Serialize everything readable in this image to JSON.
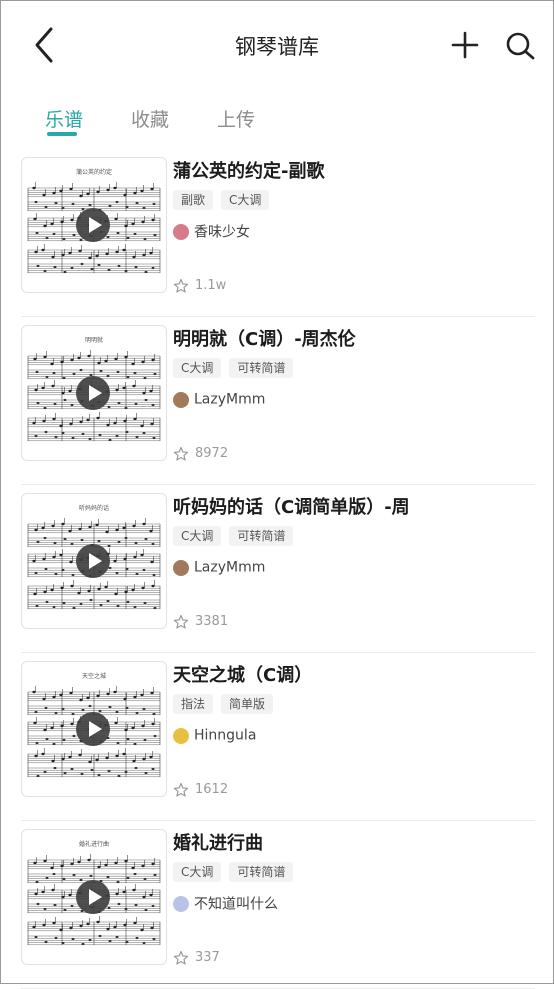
{
  "header": {
    "title": "钢琴谱库"
  },
  "tabs": [
    {
      "label": "乐谱",
      "active": true
    },
    {
      "label": "收藏",
      "active": false
    },
    {
      "label": "上传",
      "active": false
    }
  ],
  "colors": {
    "accent": "#2aa7a7"
  },
  "items": [
    {
      "title": "蒲公英的约定-副歌",
      "thumb_caption": "蒲公英的约定",
      "tags": [
        "副歌",
        "C大调"
      ],
      "author": "香味少女",
      "avatar_color": "#d77a8a",
      "count": "1.1w"
    },
    {
      "title": "明明就（C调）-周杰伦",
      "thumb_caption": "明明就",
      "tags": [
        "C大调",
        "可转简谱"
      ],
      "author": "LazyMmm",
      "avatar_color": "#a07a5a",
      "count": "8972"
    },
    {
      "title": "听妈妈的话（C调简单版）-周",
      "thumb_caption": "听妈妈的话",
      "tags": [
        "C大调",
        "可转简谱"
      ],
      "author": "LazyMmm",
      "avatar_color": "#a07a5a",
      "count": "3381"
    },
    {
      "title": "天空之城（C调）",
      "thumb_caption": "天空之城",
      "tags": [
        "指法",
        "简单版"
      ],
      "author": "Hinngula",
      "avatar_color": "#e8c040",
      "count": "1612"
    },
    {
      "title": "婚礼进行曲",
      "thumb_caption": "婚礼进行曲",
      "tags": [
        "C大调",
        "可转简谱"
      ],
      "author": "不知道叫什么",
      "avatar_color": "#b9c3e8",
      "count": "337"
    }
  ]
}
